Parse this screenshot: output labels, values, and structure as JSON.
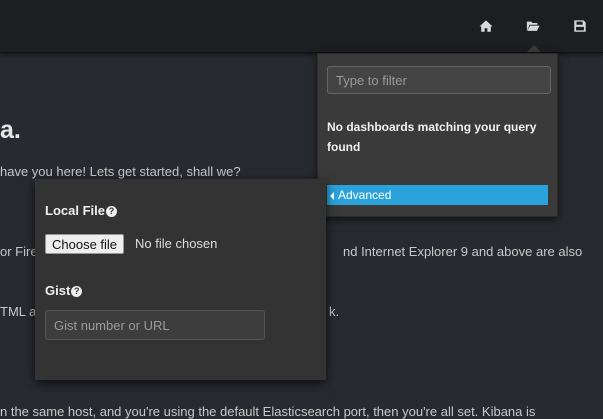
{
  "navbar": {
    "icons": [
      "home-icon",
      "folder-open-icon",
      "save-icon"
    ]
  },
  "background": {
    "title_fragment": "a.",
    "line1": "have you here! Lets get started, shall we?",
    "line2_left": "or Fire",
    "line2_right": "nd Internet Explorer 9 and above are also",
    "line3_left": "TML a",
    "line3_right": "k.",
    "line4": "n the same host, and you're using the default Elasticsearch port, then you're all set. Kibana is"
  },
  "load_menu": {
    "filter_placeholder": "Type to filter",
    "no_results": "No dashboards matching your query found",
    "advanced_label": "Advanced"
  },
  "advanced_panel": {
    "local_file_label": "Local File",
    "choose_file_label": "Choose file",
    "no_file_text": "No file chosen",
    "gist_label": "Gist",
    "gist_placeholder": "Gist number or URL",
    "help_glyph": "?"
  },
  "colors": {
    "navbar": "#1c1e22",
    "background": "#272b30",
    "panel": "#3a3a3a",
    "accent": "#2aa3dd"
  }
}
